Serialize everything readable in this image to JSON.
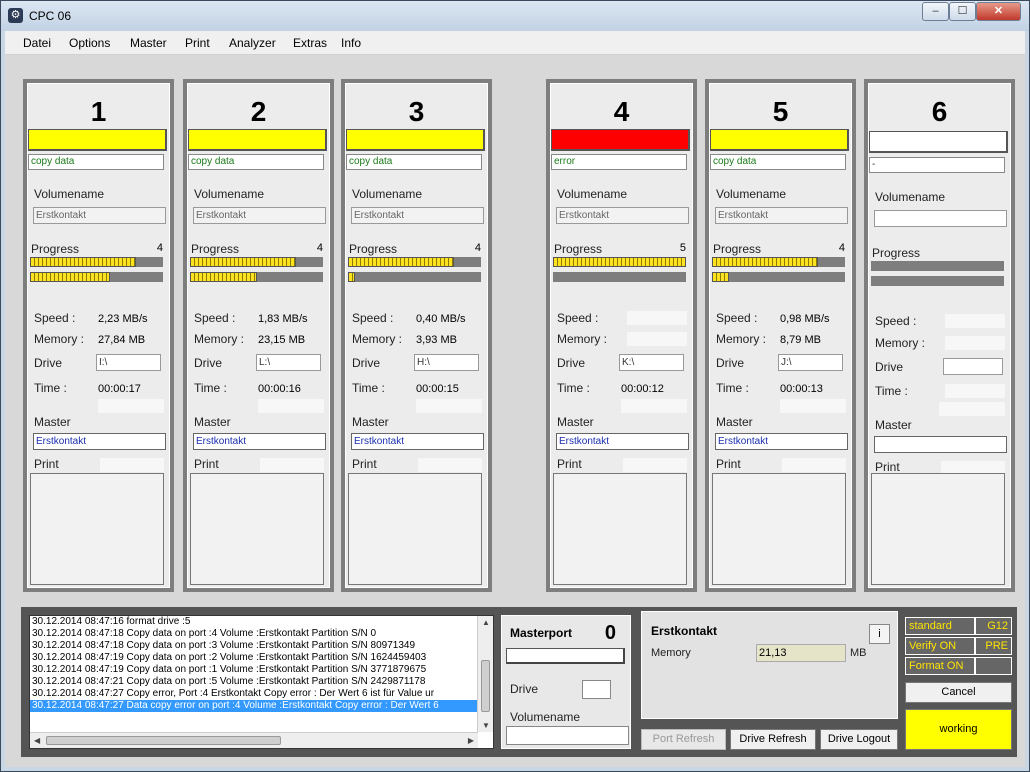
{
  "window": {
    "title": "CPC 06",
    "min": "–",
    "max": "☐",
    "close": "✕"
  },
  "menu": [
    "Datei",
    "Options",
    "Master",
    "Print",
    "Analyzer",
    "Extras",
    "Info"
  ],
  "panels": [
    {
      "number": "1",
      "status_color": "#ffff00",
      "status": "copy data",
      "volumename_label": "Volumename",
      "volumename": "Erstkontakt",
      "progress_label": "Progress",
      "progress_count": "4",
      "progress_top": 0.8,
      "progress_bottom": 0.6,
      "speed_label": "Speed :",
      "speed": "2,23 MB/s",
      "memory_label": "Memory :",
      "memory": "27,84 MB",
      "drive_label": "Drive",
      "drive": "I:\\",
      "time_label": "Time :",
      "time": "00:00:17",
      "master_label": "Master",
      "master": "Erstkontakt",
      "print_label": "Print"
    },
    {
      "number": "2",
      "status_color": "#ffff00",
      "status": "copy data",
      "volumename_label": "Volumename",
      "volumename": "Erstkontakt",
      "progress_label": "Progress",
      "progress_count": "4",
      "progress_top": 0.8,
      "progress_bottom": 0.5,
      "speed_label": "Speed :",
      "speed": "1,83 MB/s",
      "memory_label": "Memory :",
      "memory": "23,15 MB",
      "drive_label": "Drive",
      "drive": "L:\\",
      "time_label": "Time :",
      "time": "00:00:16",
      "master_label": "Master",
      "master": "Erstkontakt",
      "print_label": "Print"
    },
    {
      "number": "3",
      "status_color": "#ffff00",
      "status": "copy data",
      "volumename_label": "Volumename",
      "volumename": "Erstkontakt",
      "progress_label": "Progress",
      "progress_count": "4",
      "progress_top": 0.8,
      "progress_bottom": 0.05,
      "speed_label": "Speed :",
      "speed": "0,40 MB/s",
      "memory_label": "Memory :",
      "memory": "3,93 MB",
      "drive_label": "Drive",
      "drive": "H:\\",
      "time_label": "Time :",
      "time": "00:00:15",
      "master_label": "Master",
      "master": "Erstkontakt",
      "print_label": "Print"
    },
    {
      "number": "4",
      "status_color": "#ff0000",
      "status": "error",
      "volumename_label": "Volumename",
      "volumename": "Erstkontakt",
      "progress_label": "Progress",
      "progress_count": "5",
      "progress_top": 1.0,
      "progress_bottom": 0.0,
      "speed_label": "Speed :",
      "speed": "",
      "memory_label": "Memory :",
      "memory": "",
      "drive_label": "Drive",
      "drive": "K:\\",
      "time_label": "Time :",
      "time": "00:00:12",
      "master_label": "Master",
      "master": "Erstkontakt",
      "print_label": "Print"
    },
    {
      "number": "5",
      "status_color": "#ffff00",
      "status": "copy data",
      "volumename_label": "Volumename",
      "volumename": "Erstkontakt",
      "progress_label": "Progress",
      "progress_count": "4",
      "progress_top": 0.8,
      "progress_bottom": 0.13,
      "speed_label": "Speed :",
      "speed": "0,98 MB/s",
      "memory_label": "Memory :",
      "memory": "8,79 MB",
      "drive_label": "Drive",
      "drive": "J:\\",
      "time_label": "Time :",
      "time": "00:00:13",
      "master_label": "Master",
      "master": "Erstkontakt",
      "print_label": "Print"
    },
    {
      "number": "6",
      "status_color": "#ffffff",
      "status": "-",
      "volumename_label": "Volumename",
      "volumename": "",
      "progress_label": "Progress",
      "progress_count": "",
      "progress_top": 0.0,
      "progress_bottom": 0.0,
      "speed_label": "Speed :",
      "speed": "",
      "memory_label": "Memory :",
      "memory": "",
      "drive_label": "Drive",
      "drive": "",
      "time_label": "Time :",
      "time": "",
      "master_label": "Master",
      "master": "",
      "print_label": "Print"
    }
  ],
  "log": {
    "lines": [
      "30.12.2014 08:47:16 format drive :5",
      "30.12.2014 08:47:18 Copy data on port :4  Volume :Erstkontakt  Partition S/N 0",
      "30.12.2014 08:47:18 Copy data on port :3  Volume :Erstkontakt  Partition S/N 80971349",
      "30.12.2014 08:47:19 Copy data on port :2  Volume :Erstkontakt  Partition S/N 1624459403",
      "30.12.2014 08:47:19 Copy data on port :1  Volume :Erstkontakt  Partition S/N 3771879675",
      "30.12.2014 08:47:21 Copy data on port :5  Volume :Erstkontakt  Partition S/N 2429871178",
      "30.12.2014 08:47:27 Copy error, Port :4   Erstkontakt    Copy error : Der Wert 6 ist für Value ur",
      "30.12.2014 08:47:27 Data copy error on port :4  Volume :Erstkontakt   Copy error : Der Wert 6"
    ],
    "selected_index": 7
  },
  "masterport": {
    "title": "Masterport",
    "number": "0",
    "drive_label": "Drive",
    "volumename_label": "Volumename"
  },
  "info": {
    "title": "Erstkontakt",
    "info_button": "i",
    "memory_label": "Memory",
    "memory_value": "21,13",
    "memory_unit": "MB"
  },
  "buttons": {
    "port_refresh": "Port Refresh",
    "drive_refresh": "Drive Refresh",
    "drive_logout": "Drive Logout",
    "cancel": "Cancel",
    "working": "working"
  },
  "flags": [
    {
      "label": "standard",
      "value": "G12"
    },
    {
      "label": "Verify ON",
      "value": "PRE"
    },
    {
      "label": "Format ON",
      "value": ""
    }
  ]
}
